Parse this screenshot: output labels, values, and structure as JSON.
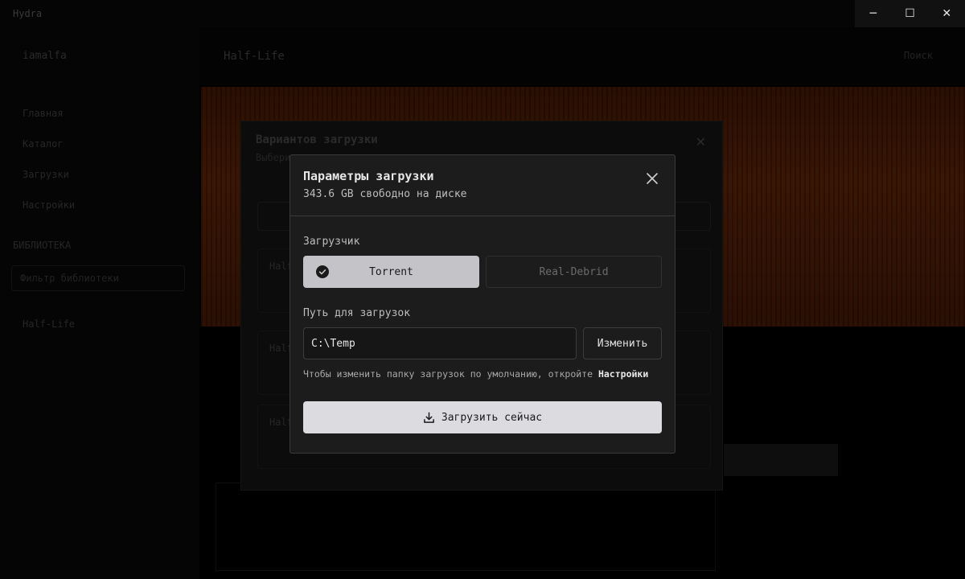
{
  "window": {
    "app_title": "Hydra",
    "minimize_glyph": "─",
    "maximize_glyph": "☐",
    "close_glyph": "✕"
  },
  "background": {
    "sidebar": {
      "user": "iamalfa",
      "items": [
        "Главная",
        "Каталог",
        "Загрузки",
        "Настройки"
      ],
      "section": "БИБЛИОТЕКА",
      "search_placeholder": "Фильтр библиотеки",
      "game": "Half-Life"
    },
    "header": {
      "game_title": "Half-Life",
      "search_placeholder": "Поиск"
    },
    "variants_modal": {
      "title": "Вариантов загрузки",
      "subtitle": "Выберите вариант загрузки",
      "item_names": [
        "Half-Life",
        "Half-Life",
        "Half-Life"
      ]
    }
  },
  "modal": {
    "title": "Параметры загрузки",
    "subtitle": "343.6 GB свободно на диске",
    "close_icon": "close-icon",
    "downloader_label": "Загрузчик",
    "downloaders": [
      {
        "label": "Torrent",
        "selected": true
      },
      {
        "label": "Real-Debrid",
        "selected": false
      }
    ],
    "path_label": "Путь для загрузок",
    "path_value": "C:\\Temp",
    "change_button": "Изменить",
    "hint_text": "Чтобы изменить папку загрузок по умолчанию, откройте ",
    "hint_link": "Настройки",
    "download_button": "Загрузить сейчас",
    "download_icon": "download-icon",
    "colors": {
      "modal_bg": "#1c1c1c",
      "border": "#3a3a3a",
      "selected_option_bg": "#c4c4c8",
      "primary_button_bg": "#dcdce0"
    }
  }
}
